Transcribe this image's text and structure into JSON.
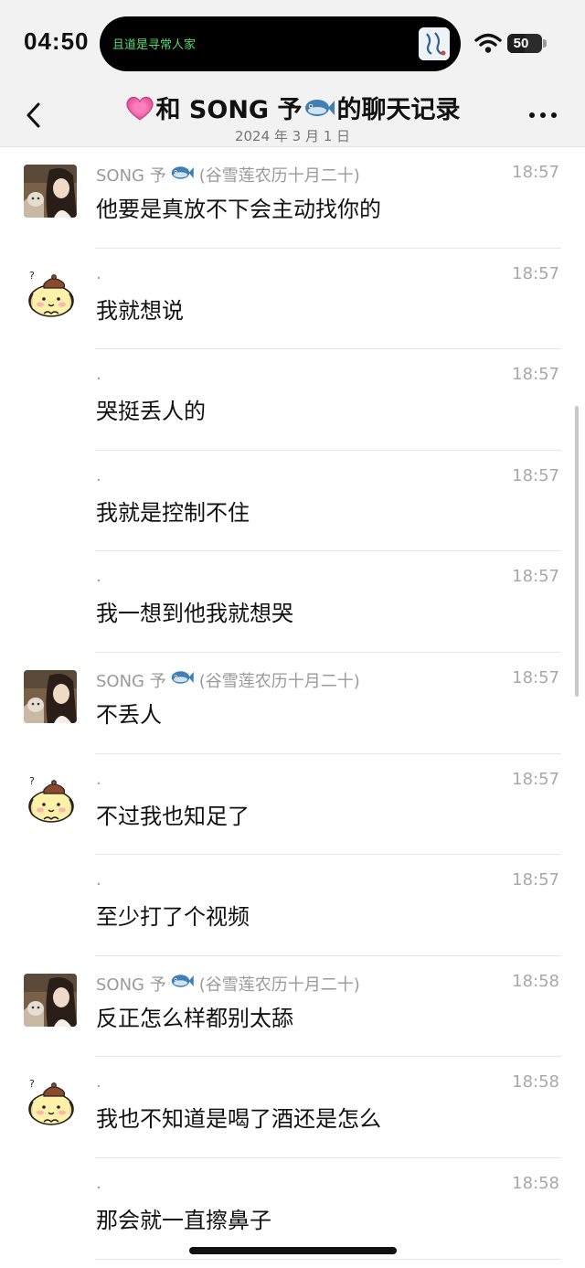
{
  "status_bar": {
    "time": "04:50",
    "now_playing": "且道是寻常人家",
    "battery": "50"
  },
  "nav": {
    "title": "和 SONG 予",
    "title_suffix": "的聊天记录",
    "date": "2024 年 3 月 1 日"
  },
  "messages": [
    {
      "avatar": "girl",
      "sender": "SONG 予",
      "sender_note": "(谷雪莲农历十月二十)",
      "time": "18:57",
      "text": "他要是真放不下会主动找你的"
    },
    {
      "avatar": "dog",
      "sender": ".",
      "sender_note": "",
      "time": "18:57",
      "text": "我就想说"
    },
    {
      "avatar": "none",
      "sender": ".",
      "sender_note": "",
      "time": "18:57",
      "text": "哭挺丢人的"
    },
    {
      "avatar": "none",
      "sender": ".",
      "sender_note": "",
      "time": "18:57",
      "text": "我就是控制不住"
    },
    {
      "avatar": "none",
      "sender": ".",
      "sender_note": "",
      "time": "18:57",
      "text": "我一想到他我就想哭"
    },
    {
      "avatar": "girl",
      "sender": "SONG 予",
      "sender_note": "(谷雪莲农历十月二十)",
      "time": "18:57",
      "text": "不丢人"
    },
    {
      "avatar": "dog",
      "sender": ".",
      "sender_note": "",
      "time": "18:57",
      "text": "不过我也知足了"
    },
    {
      "avatar": "none",
      "sender": ".",
      "sender_note": "",
      "time": "18:57",
      "text": "至少打了个视频"
    },
    {
      "avatar": "girl",
      "sender": "SONG 予",
      "sender_note": "(谷雪莲农历十月二十)",
      "time": "18:58",
      "text": "反正怎么样都别太舔"
    },
    {
      "avatar": "dog",
      "sender": ".",
      "sender_note": "",
      "time": "18:58",
      "text": "我也不知道是喝了酒还是怎么"
    },
    {
      "avatar": "none",
      "sender": ".",
      "sender_note": "",
      "time": "18:58",
      "text": "那会就一直擦鼻子"
    }
  ],
  "colors": {
    "header_bg": "#f2f2f2",
    "fish": "#3f7fb4",
    "heart": "#ff69b4",
    "meta_gray": "#9a9a9a"
  }
}
